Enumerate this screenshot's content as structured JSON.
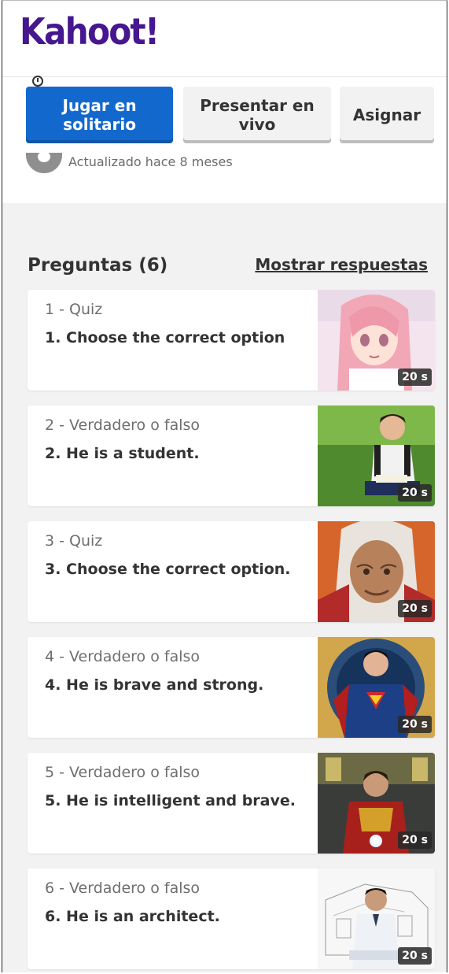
{
  "brand": {
    "logo_text": "Kahoot!"
  },
  "actions": {
    "play_solo": "Jugar en solitario",
    "present_live": "Presentar en vivo",
    "assign": "Asignar"
  },
  "meta": {
    "updated": "Actualizado hace 8 meses"
  },
  "questions": {
    "title": "Preguntas (6)",
    "show_answers": "Mostrar respuestas",
    "items": [
      {
        "type": "1 - Quiz",
        "text": "1. Choose the correct option",
        "time": "20 s",
        "image": "anime-girl"
      },
      {
        "type": "2 - Verdadero o falso",
        "text": "2. He is a student.",
        "time": "20 s",
        "image": "student-on-grass"
      },
      {
        "type": "3 - Quiz",
        "text": "3. Choose the correct option.",
        "time": "20 s",
        "image": "old-woman-cartoon"
      },
      {
        "type": "4 - Verdadero o falso",
        "text": "4. He is brave and strong.",
        "time": "20 s",
        "image": "superman"
      },
      {
        "type": "5 - Verdadero o falso",
        "text": "5. He is intelligent and brave.",
        "time": "20 s",
        "image": "iron-man"
      },
      {
        "type": "6 - Verdadero o falso",
        "text": "6. He is an architect.",
        "time": "20 s",
        "image": "architect-sketch"
      }
    ]
  },
  "colors": {
    "brand_purple": "#46178f",
    "primary_blue": "#1368ce",
    "text_dark": "#333333",
    "text_muted": "#6e6e6e"
  }
}
